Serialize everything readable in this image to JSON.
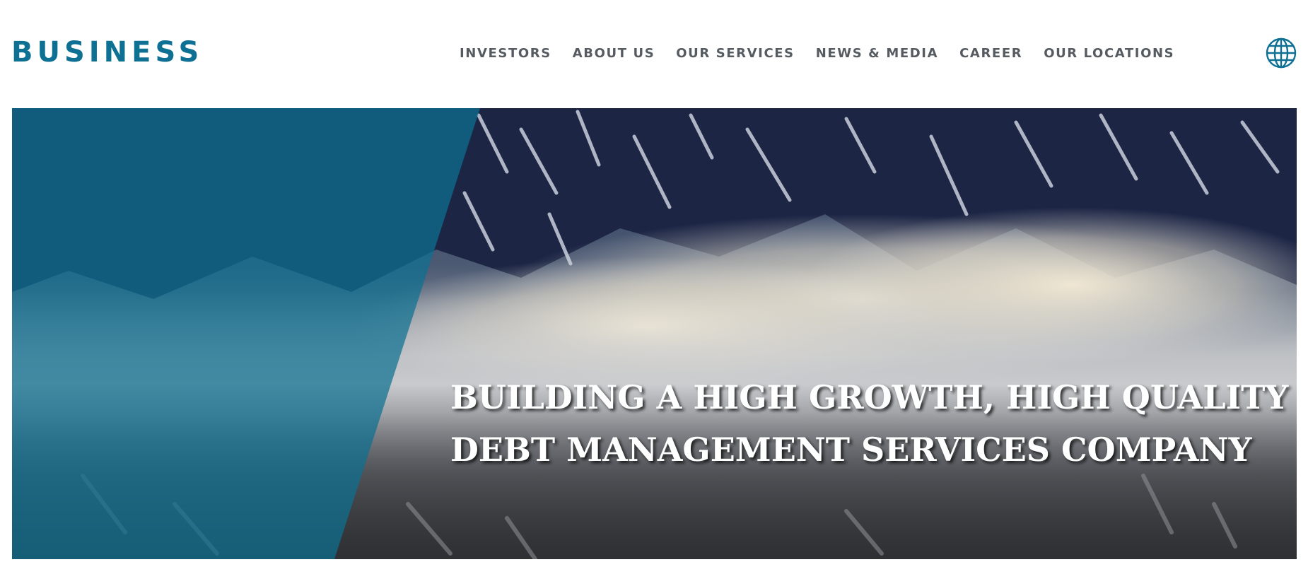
{
  "header": {
    "logo_text": "BUSINESS",
    "brand_color": "#0e7092",
    "nav": [
      {
        "label": "INVESTORS"
      },
      {
        "label": "ABOUT US"
      },
      {
        "label": "OUR SERVICES"
      },
      {
        "label": "NEWS & MEDIA"
      },
      {
        "label": "CAREER"
      },
      {
        "label": "OUR LOCATIONS"
      }
    ],
    "language_icon": "globe-icon"
  },
  "hero": {
    "headline_line1": "BUILDING A HIGH GROWTH, HIGH QUALITY",
    "headline_line2": "DEBT MANAGEMENT SERVICES COMPANY",
    "overlay_color": "#0e7092",
    "image": "snowy-mountains-with-clouds"
  }
}
